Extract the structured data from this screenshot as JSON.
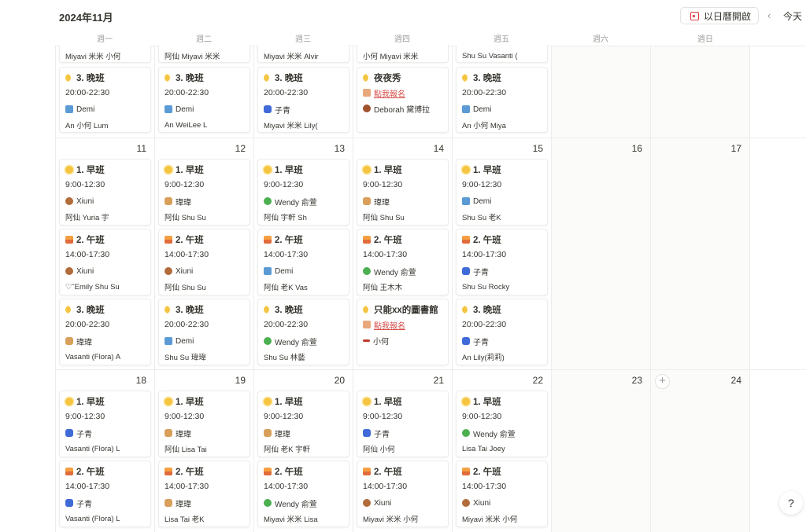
{
  "header": {
    "month": "2024年11月",
    "open_in_calendar": "以日曆開啟",
    "prev_arrow": "‹",
    "today": "今天"
  },
  "weekdays": [
    "週一",
    "週二",
    "週三",
    "週四",
    "週五",
    "週六",
    "週日"
  ],
  "week_top": {
    "overflow": [
      {
        "text": "Miyavi 米米   小何",
        "icons": [
          "smile",
          "stick"
        ]
      },
      {
        "text": "阿仙   Miyavi 米米",
        "icons": [
          "tulip",
          "smile"
        ]
      },
      {
        "text": "Miyavi 米米   Alvir",
        "icons": [
          "smile",
          "bulb"
        ]
      },
      {
        "text": "小何   Miyavi 米米",
        "icons": [
          "stick",
          "smile"
        ]
      },
      {
        "text": "Shu Su   Vasanti (",
        "icons": [
          "horse",
          "flower"
        ]
      }
    ],
    "cards": [
      {
        "title": "3. 晚班",
        "title_icon": "moon",
        "time": "20:00-22:30",
        "who": "Demi",
        "who_icon": "plane",
        "people": "An   小何   Lum"
      },
      {
        "title": "3. 晚班",
        "title_icon": "moon",
        "time": "20:00-22:30",
        "who": "Demi",
        "who_icon": "plane",
        "people": "An   WeiLee   L"
      },
      {
        "title": "3. 晚班",
        "title_icon": "moon",
        "time": "20:00-22:30",
        "who": "子青",
        "who_icon": "hand",
        "people": "Miyavi 米米   Lily("
      },
      {
        "title": "夜夜秀",
        "title_icon": "moon",
        "signup": "點我報名",
        "who": "Deborah 黛博拉",
        "who_icon": "hedgehog"
      },
      {
        "title": "3. 晚班",
        "title_icon": "moon",
        "time": "20:00-22:30",
        "who": "Demi",
        "who_icon": "plane",
        "people": "An   小何   Miya"
      }
    ]
  },
  "week2": {
    "days": [
      "11",
      "12",
      "13",
      "14",
      "15",
      "16",
      "17"
    ],
    "cols": [
      [
        {
          "title": "1. 早班",
          "title_icon": "sun",
          "time": "9:00-12:30",
          "who": "Xiuni",
          "who_icon": "squirrel",
          "people": "阿仙   Yuria   宇"
        },
        {
          "title": "2. 午班",
          "title_icon": "sunset",
          "time": "14:00-17:30",
          "who": "Xiuni",
          "who_icon": "squirrel",
          "people": "♡˘Emily   Shu Su"
        },
        {
          "title": "3. 晚班",
          "title_icon": "moon",
          "time": "20:00-22:30",
          "who": "瑋瑋",
          "who_icon": "bread",
          "people": "Vasanti (Flora)   A"
        }
      ],
      [
        {
          "title": "1. 早班",
          "title_icon": "sun",
          "time": "9:00-12:30",
          "who": "瑋瑋",
          "who_icon": "bread",
          "people": "阿仙   Shu Su"
        },
        {
          "title": "2. 午班",
          "title_icon": "sunset",
          "time": "14:00-17:30",
          "who": "Xiuni",
          "who_icon": "squirrel",
          "people": "阿仙   Shu Su"
        },
        {
          "title": "3. 晚班",
          "title_icon": "moon",
          "time": "20:00-22:30",
          "who": "Demi",
          "who_icon": "plane",
          "people": "Shu Su   瑋瑋"
        }
      ],
      [
        {
          "title": "1. 早班",
          "title_icon": "sun",
          "time": "9:00-12:30",
          "who": "Wendy 俞萱",
          "who_icon": "leaf",
          "people": "阿仙   宇軒   Sh"
        },
        {
          "title": "2. 午班",
          "title_icon": "sunset",
          "time": "14:00-17:30",
          "who": "Demi",
          "who_icon": "plane",
          "people": "阿仙   老K   Vas"
        },
        {
          "title": "3. 晚班",
          "title_icon": "moon",
          "time": "20:00-22:30",
          "who": "Wendy 俞萱",
          "who_icon": "leaf",
          "people": "Shu Su   林藝"
        }
      ],
      [
        {
          "title": "1. 早班",
          "title_icon": "sun",
          "time": "9:00-12:30",
          "who": "瑋瑋",
          "who_icon": "bread",
          "people": "阿仙   Shu Su"
        },
        {
          "title": "2. 午班",
          "title_icon": "sunset",
          "time": "14:00-17:30",
          "who": "Wendy 俞萱",
          "who_icon": "leaf",
          "people": "阿仙   王木木"
        },
        {
          "title": "只能xx的圖書館",
          "title_icon": "moon",
          "signup": "點我報名",
          "who": "小何",
          "who_icon": "stick"
        }
      ],
      [
        {
          "title": "1. 早班",
          "title_icon": "sun",
          "time": "9:00-12:30",
          "who": "Demi",
          "who_icon": "plane",
          "people": "Shu Su   老K"
        },
        {
          "title": "2. 午班",
          "title_icon": "sunset",
          "time": "14:00-17:30",
          "who": "子青",
          "who_icon": "hand",
          "people": "Shu Su   Rocky"
        },
        {
          "title": "3. 晚班",
          "title_icon": "moon",
          "time": "20:00-22:30",
          "who": "子青",
          "who_icon": "hand",
          "people": "An   Lily(莉莉)"
        }
      ]
    ]
  },
  "week3": {
    "days": [
      "18",
      "19",
      "20",
      "21",
      "22",
      "23",
      "24"
    ],
    "plus": "+",
    "cols": [
      [
        {
          "title": "1. 早班",
          "title_icon": "sun",
          "time": "9:00-12:30",
          "who": "子青",
          "who_icon": "hand",
          "people": "Vasanti (Flora)   L"
        },
        {
          "title": "2. 午班",
          "title_icon": "sunset",
          "time": "14:00-17:30",
          "who": "子青",
          "who_icon": "hand",
          "people": "Vasanti (Flora)   L"
        }
      ],
      [
        {
          "title": "1. 早班",
          "title_icon": "sun",
          "time": "9:00-12:30",
          "who": "瑋瑋",
          "who_icon": "bread",
          "people": "阿仙   Lisa Tai"
        },
        {
          "title": "2. 午班",
          "title_icon": "sunset",
          "time": "14:00-17:30",
          "who": "瑋瑋",
          "who_icon": "bread",
          "people": "Lisa Tai   老K"
        }
      ],
      [
        {
          "title": "1. 早班",
          "title_icon": "sun",
          "time": "9:00-12:30",
          "who": "瑋瑋",
          "who_icon": "bread",
          "people": "阿仙   老K   宇軒"
        },
        {
          "title": "2. 午班",
          "title_icon": "sunset",
          "time": "14:00-17:30",
          "who": "Wendy 俞萱",
          "who_icon": "leaf",
          "people": "Miyavi 米米   Lisa"
        }
      ],
      [
        {
          "title": "1. 早班",
          "title_icon": "sun",
          "time": "9:00-12:30",
          "who": "子青",
          "who_icon": "hand",
          "people": "阿仙   小何"
        },
        {
          "title": "2. 午班",
          "title_icon": "sunset",
          "time": "14:00-17:30",
          "who": "Xiuni",
          "who_icon": "squirrel",
          "people": "Miyavi 米米   小何"
        }
      ],
      [
        {
          "title": "1. 早班",
          "title_icon": "sun",
          "time": "9:00-12:30",
          "who": "Wendy 俞萱",
          "who_icon": "leaf",
          "people": "Lisa Tai   Joey"
        },
        {
          "title": "2. 午班",
          "title_icon": "sunset",
          "time": "14:00-17:30",
          "who": "Xiuni",
          "who_icon": "squirrel",
          "people": "Miyavi 米米   小何"
        }
      ]
    ]
  },
  "help_icon": "?"
}
